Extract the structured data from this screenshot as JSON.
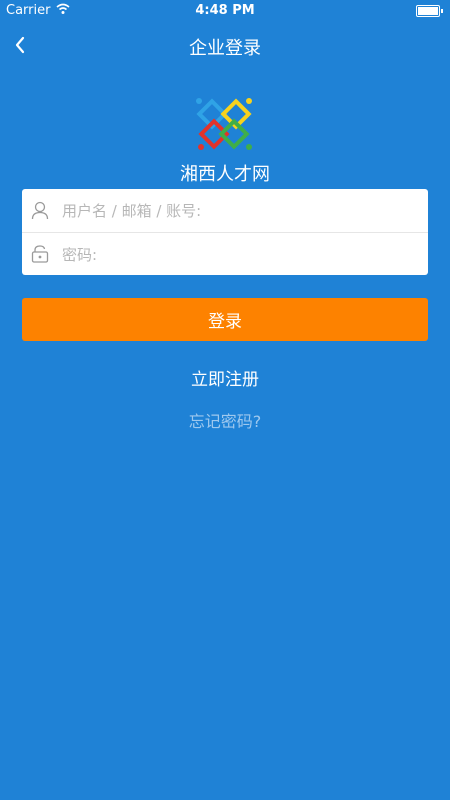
{
  "status_bar": {
    "carrier": "Carrier",
    "time": "4:48 PM"
  },
  "navbar": {
    "title": "企业登录",
    "back_icon": "chevron-left-icon"
  },
  "brand": {
    "site_name": "湘西人才网",
    "logo_colors": [
      "#2fa3e6",
      "#f7d21e",
      "#e2332b",
      "#3fae49"
    ]
  },
  "form": {
    "username_placeholder": "用户名 / 邮箱 / 账号:",
    "username_value": "",
    "username_icon": "user-icon",
    "password_placeholder": "密码:",
    "password_value": "",
    "password_icon": "lock-icon"
  },
  "actions": {
    "login_label": "登录",
    "register_label": "立即注册",
    "forgot_label": "忘记密码?"
  },
  "colors": {
    "background": "#1f82d6",
    "login_button": "#fd8200"
  }
}
